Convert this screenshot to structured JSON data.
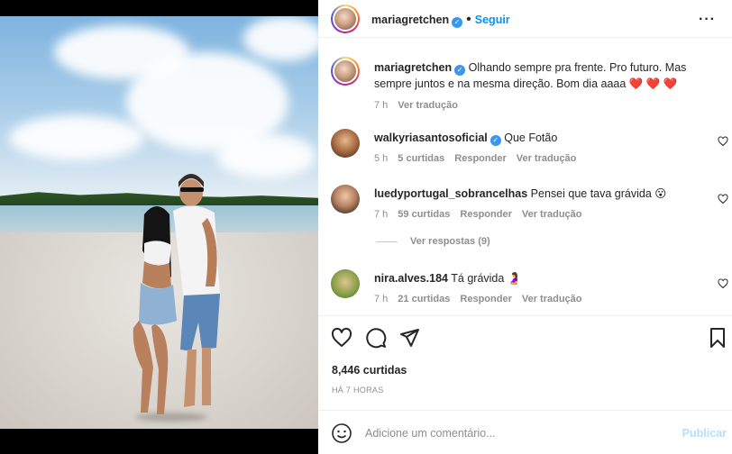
{
  "post": {
    "author": "mariagretchen",
    "follow_label": "Seguir",
    "caption": "Olhando sempre pra frente. Pro futuro. Mas sempre juntos e na mesma direção. Bom dia aaaa ❤️ ❤️ ❤️",
    "caption_time": "7 h",
    "translate_label": "Ver tradução"
  },
  "comments": [
    {
      "user": "walkyriasantosoficial",
      "verified": true,
      "text": "Que Fotão",
      "time": "5 h",
      "likes": "5 curtidas",
      "reply": "Responder",
      "translate": "Ver tradução"
    },
    {
      "user": "luedyportugal_sobrancelhas",
      "verified": false,
      "text": "Pensei que tava grávida 😮",
      "time": "7 h",
      "likes": "59 curtidas",
      "reply": "Responder",
      "translate": "Ver tradução",
      "view_replies": "Ver respostas (9)"
    },
    {
      "user": "nira.alves.184",
      "verified": false,
      "text": "Tá grávida 🤰",
      "time": "7 h",
      "likes": "21 curtidas",
      "reply": "Responder",
      "translate": "Ver tradução"
    }
  ],
  "footer": {
    "likes": "8,446 curtidas",
    "posted": "HÁ 7 HORAS",
    "comment_placeholder": "Adicione um comentário...",
    "publish_label": "Publicar"
  },
  "icons": {
    "like": "heart-icon",
    "comment": "comment-icon",
    "share": "paper-plane-icon",
    "save": "bookmark-icon",
    "emoji": "smiley-icon",
    "more": "more-options-icon",
    "verified": "verified-badge-icon"
  },
  "colors": {
    "accent": "#0095f6",
    "verified": "#3897f0",
    "heart": "#ed4956",
    "publish_disabled": "#b2dffc"
  }
}
